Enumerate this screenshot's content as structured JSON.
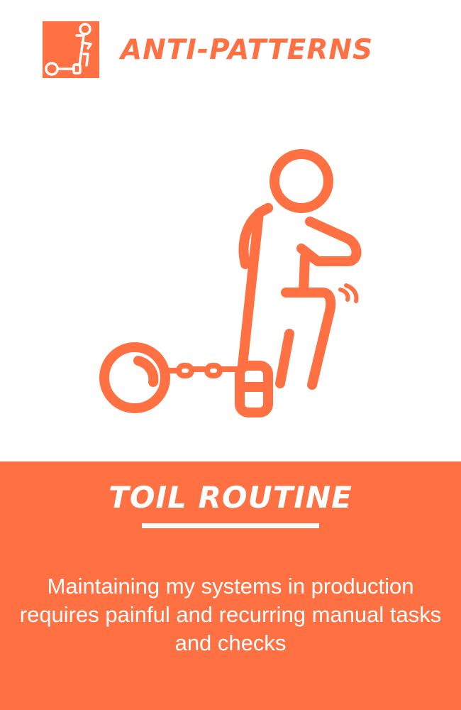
{
  "header": {
    "category": "ANTI-PATTERNS",
    "logo_icon": "ball-and-chain-icon"
  },
  "illustration": {
    "icon": "ball-and-chain-person-icon"
  },
  "card": {
    "title": "TOIL ROUTINE",
    "description": "Maintaining my systems in production requires painful and recurring manual tasks and checks"
  },
  "colors": {
    "accent": "#ff7043",
    "text_on_accent": "#ffffff",
    "background": "#ffffff"
  }
}
